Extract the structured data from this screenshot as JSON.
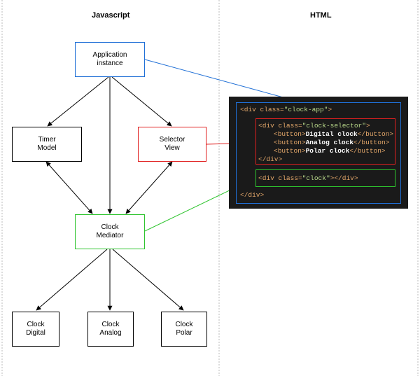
{
  "headers": {
    "left": "Javascript",
    "right": "HTML"
  },
  "colors": {
    "blue": "#1f6fd6",
    "red": "#e02020",
    "green": "#2ec42e",
    "black": "#000000",
    "divider": "#bbbbbb"
  },
  "nodes": {
    "app": "Application\ninstance",
    "timer": "Timer\nModel",
    "selector": "Selector\nView",
    "mediator": "Clock\nMediator",
    "digital": "Clock\nDigital",
    "analog": "Clock\nAnalog",
    "polar": "Clock\nPolar"
  },
  "code": {
    "app_open": {
      "tag_open": "<div ",
      "attr": "class=",
      "value": "\"clock-app\"",
      "tag_close": ">"
    },
    "selector_open": {
      "tag_open": "<div ",
      "attr": "class=",
      "value": "\"clock-selector\"",
      "tag_close": ">"
    },
    "buttons": [
      {
        "open": "<button>",
        "text": "Digital clock",
        "close": "</button>"
      },
      {
        "open": "<button>",
        "text": "Analog clock",
        "close": "</button>"
      },
      {
        "open": "<button>",
        "text": "Polar clock",
        "close": "</button>"
      }
    ],
    "selector_close": "</div>",
    "clock_div": {
      "tag_open": "<div ",
      "attr": "class=",
      "value": "\"clock\"",
      "tag_close": "></div>"
    },
    "app_close": "</div>"
  }
}
